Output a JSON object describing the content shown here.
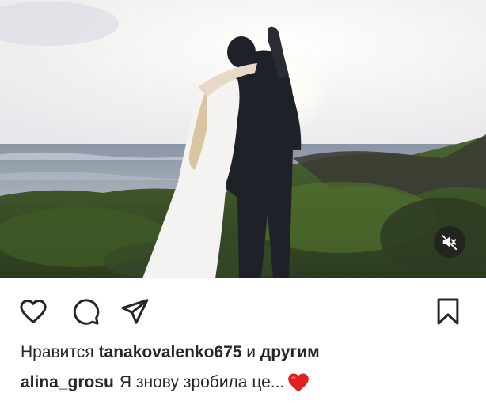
{
  "post": {
    "media": {
      "kind": "video",
      "description_icon": "photo-couple-sunset",
      "mute_icon": "speaker-muted-icon"
    },
    "actions": {
      "like_icon": "heart-icon",
      "comment_icon": "comment-icon",
      "share_icon": "paper-plane-icon",
      "save_icon": "bookmark-icon"
    },
    "likes": {
      "prefix": "Нравится",
      "user": "tanakovalenko675",
      "joiner": "и",
      "others": "другим"
    },
    "caption": {
      "author": "alina_grosu",
      "text": "Я знову зробила це...",
      "emoji": "red-heart-emoji"
    }
  },
  "colors": {
    "text": "#262626",
    "heart": "#e0201f",
    "mute_bg": "#1e1e1e"
  }
}
